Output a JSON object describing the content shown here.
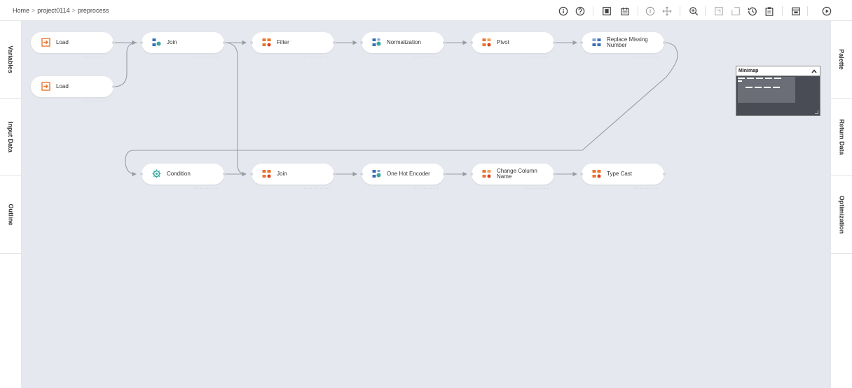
{
  "breadcrumb": {
    "home": "Home",
    "project": "project0114",
    "current": "preprocess",
    "sep": ">"
  },
  "toolbar": {
    "icons": [
      "info-icon",
      "help-icon",
      "panel-icon",
      "batch-icon",
      "info-outline-icon",
      "move-icon",
      "zoom-icon",
      "undo-icon",
      "redo-icon",
      "history-icon",
      "clipboard-icon",
      "calendar-icon",
      "play-icon"
    ]
  },
  "left_panel": {
    "tabs": [
      "Variables",
      "Input Data",
      "Outline"
    ]
  },
  "right_panel": {
    "tabs": [
      "Palette",
      "Return Data",
      "Optimization"
    ]
  },
  "minimap": {
    "title": "Minimap"
  },
  "nodes": [
    {
      "id": "n1",
      "label": "Load",
      "icon": "load-icon"
    },
    {
      "id": "n2",
      "label": "Load",
      "icon": "load-icon"
    },
    {
      "id": "n3",
      "label": "Join",
      "icon": "join-icon"
    },
    {
      "id": "n4",
      "label": "Filter",
      "icon": "filter-icon"
    },
    {
      "id": "n5",
      "label": "Normalization",
      "icon": "normalization-icon"
    },
    {
      "id": "n6",
      "label": "Pivot",
      "icon": "pivot-icon"
    },
    {
      "id": "n7",
      "label": "Replace Missing Number",
      "icon": "replace-missing-icon"
    },
    {
      "id": "n8",
      "label": "Condition",
      "icon": "condition-icon"
    },
    {
      "id": "n9",
      "label": "Join",
      "icon": "join-icon"
    },
    {
      "id": "n10",
      "label": "One Hot Encoder",
      "icon": "encoder-icon"
    },
    {
      "id": "n11",
      "label": "Change Column Name",
      "icon": "rename-icon"
    },
    {
      "id": "n12",
      "label": "Type Cast",
      "icon": "typecast-icon"
    }
  ],
  "colors": {
    "canvas": "#e6e8ef",
    "orange": "#e8772e",
    "blue": "#3d6fb6",
    "teal": "#3aa6a0",
    "edge": "#9a9ca3"
  }
}
